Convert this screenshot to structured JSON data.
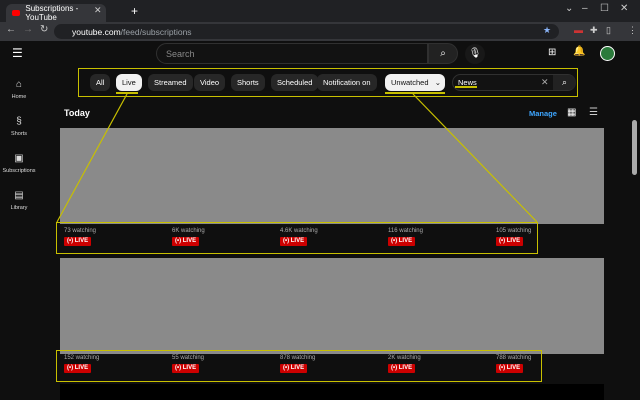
{
  "browser": {
    "tab_title": "Subscriptions - YouTube",
    "url_host": "youtube.com",
    "url_path": "/feed/subscriptions"
  },
  "masthead": {
    "search_placeholder": "Search"
  },
  "sidebar": {
    "items": [
      {
        "label": "Home",
        "icon": "home-icon"
      },
      {
        "label": "Shorts",
        "icon": "shorts-icon"
      },
      {
        "label": "Subscriptions",
        "icon": "subscriptions-icon"
      },
      {
        "label": "Library",
        "icon": "library-icon"
      }
    ]
  },
  "filters": {
    "chips": [
      {
        "label": "All",
        "selected": false
      },
      {
        "label": "Live",
        "selected": true
      },
      {
        "label": "Streamed",
        "selected": false
      },
      {
        "label": "Video",
        "selected": false
      },
      {
        "label": "Shorts",
        "selected": false
      },
      {
        "label": "Scheduled",
        "selected": false
      },
      {
        "label": "Notification on",
        "selected": false
      }
    ],
    "dropdown": "Unwatched",
    "keyword": "News"
  },
  "section": {
    "title": "Today",
    "manage": "Manage"
  },
  "live_label": "LIVE",
  "rows": [
    {
      "items": [
        "73 watching",
        "6K watching",
        "4.6K watching",
        "116 watching",
        "105 watching"
      ]
    },
    {
      "items": [
        "152 watching",
        "55 watching",
        "878 watching",
        "2K watching",
        "788 watching"
      ]
    }
  ],
  "colors": {
    "highlight": "#c8c000",
    "live": "#cc0000",
    "link": "#3ea6ff"
  }
}
